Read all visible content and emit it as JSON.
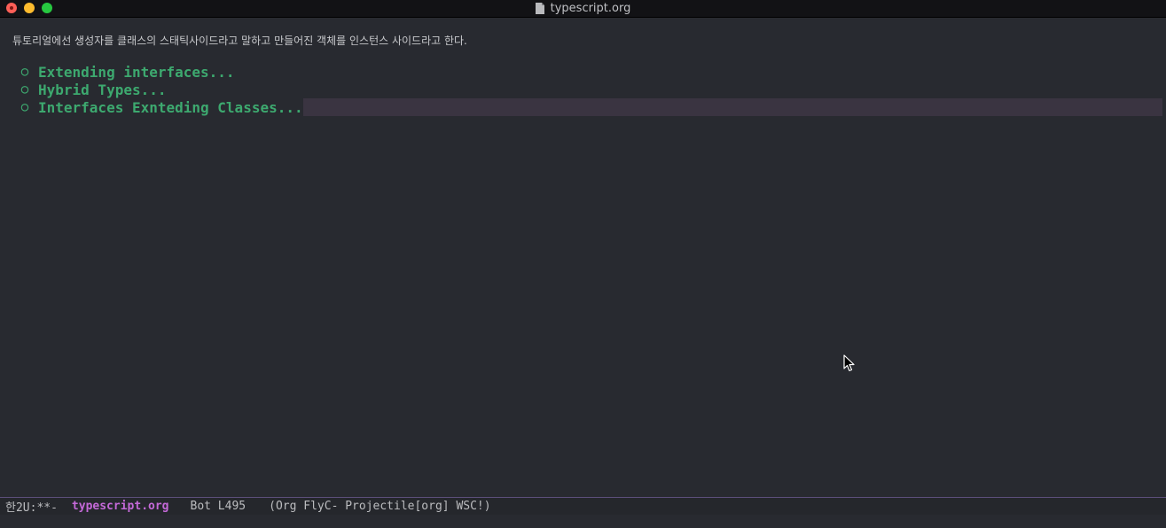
{
  "window": {
    "title": "typescript.org",
    "title_icon": "document-icon"
  },
  "editor": {
    "paragraph": "튜토리얼에선 생성자를 클래스의 스태틱사이드라고 말하고 만들어진 객체를 인스턴스 사이드라고 한다.",
    "headings": [
      {
        "bullet": "○",
        "text": "Extending interfaces..."
      },
      {
        "bullet": "○",
        "text": "Hybrid Types..."
      },
      {
        "bullet": "○",
        "text": "Interfaces Exnteding Classes..."
      }
    ]
  },
  "modeline": {
    "state": "한2U:**-",
    "buffer": "typescript.org",
    "position": "Bot L495",
    "modes": "(Org FlyC- Projectile[org] WSC!)"
  },
  "colors": {
    "background": "#282a30",
    "heading": "#3da96f",
    "buffer_name": "#c469d8",
    "current_line": "#3a3441"
  }
}
